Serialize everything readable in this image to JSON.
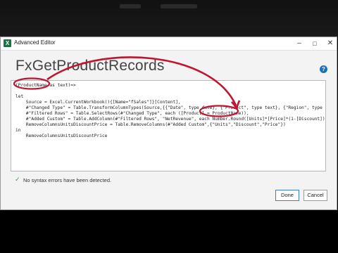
{
  "window": {
    "title": "Advanced Editor",
    "app_icon": "X",
    "controls": {
      "minimize": "–",
      "maximize": "□",
      "close": "✕"
    }
  },
  "heading": "FxGetProductRecords",
  "help_icon": "?",
  "code_lines": [
    "(ProductName as text)=>",
    "",
    "let",
    "    Source = Excel.CurrentWorkbook(){[Name=\"fSales\"]}[Content],",
    "    #\"Changed Type\" = Table.TransformColumnTypes(Source,{{\"Date\", type date}, {\"Product\", type text}, {\"Region\", type text},",
    "    #\"Filtered Rows\" = Table.SelectRows(#\"Changed Type\", each ([Product] = ProductName)),",
    "    #\"Added Custom\" = Table.AddColumn(#\"Filtered Rows\", \"NetRevenue\", each Number.Round([Units]*[Price]*(1-[Discount]),2)),",
    "    RemoveColumnsUnitsDiscountPrice = Table.RemoveColumns(#\"Added Custom\",{\"Units\",\"Discount\",\"Price\"})",
    "in",
    "    RemoveColumnsUnitsDiscountPrice"
  ],
  "status": {
    "icon": "check-icon",
    "text": "No syntax errors have been detected."
  },
  "buttons": {
    "done": "Done",
    "cancel": "Cancel"
  },
  "colors": {
    "annotation": "#c0152f",
    "help": "#1f6fb8",
    "check": "#3a9a3a"
  }
}
